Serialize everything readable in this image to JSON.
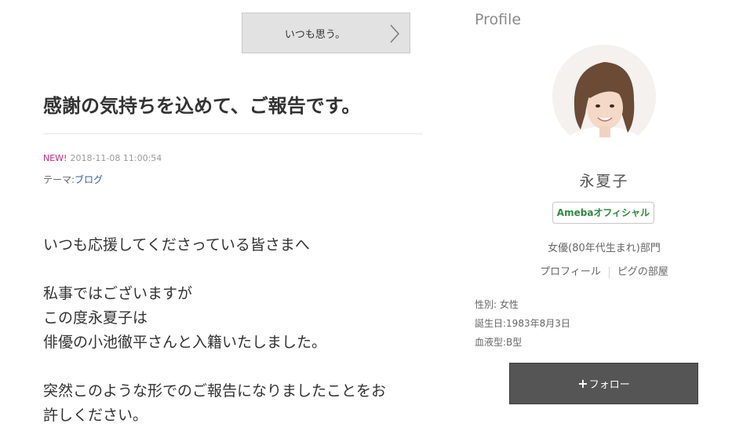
{
  "article": {
    "nav_next_label": "いつも思う。",
    "title": "感謝の気持ちを込めて、ご報告です。",
    "new_badge": "NEW!",
    "datetime": "2018-11-08 11:00:54",
    "theme_label": "テーマ:",
    "theme_value": "ブログ",
    "paragraphs": [
      [
        "いつも応援してくださっている皆さまへ"
      ],
      [
        "私事ではございますが",
        "この度永夏子は",
        "俳優の小池徹平さんと入籍いたしました。"
      ],
      [
        "突然このような形でのご報告になりましたことをお",
        "許しください。"
      ]
    ]
  },
  "profile": {
    "heading": "Profile",
    "nickname": "永夏子",
    "official_badge": "Amebaオフィシャル",
    "category": "女優(80年代生まれ)部門",
    "links": [
      "プロフィール",
      "ピグの部屋"
    ],
    "facts": [
      "性別: 女性",
      "誕生日:1983年8月3日",
      "血液型:B型"
    ],
    "follow_label": "フォロー",
    "follow_icon": "plus-icon"
  },
  "colors": {
    "new_badge": "#c7287a",
    "theme_link": "#2d5fa0",
    "official_text": "#2e8b3d",
    "follow_bg": "#555555"
  }
}
